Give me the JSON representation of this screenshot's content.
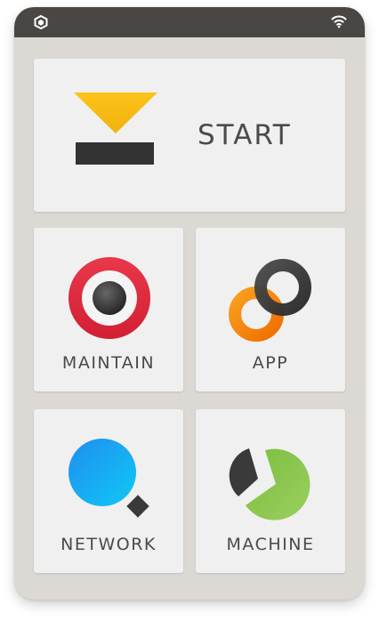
{
  "status_bar": {
    "logo_icon": "hexagon-logo-icon",
    "wifi_icon": "wifi-icon"
  },
  "tiles": {
    "start": {
      "label": "START",
      "icon": "start-funnel-icon"
    },
    "maintain": {
      "label": "MAINTAIN",
      "icon": "target-ring-icon"
    },
    "app": {
      "label": "APP",
      "icon": "linked-rings-icon"
    },
    "network": {
      "label": "NETWORK",
      "icon": "magnifier-icon"
    },
    "machine": {
      "label": "MACHINE",
      "icon": "pie-chart-icon"
    }
  },
  "colors": {
    "status_bar": "#4a4643",
    "device_bg": "#dcd8d3",
    "tile_bg": "#f0f0f0",
    "label_text": "#4a4a4a",
    "start_yellow": "#f5c018",
    "start_bar": "#333333",
    "maintain_red": "#e02d3e",
    "app_orange": "#f58a0a",
    "app_dark": "#3a3a3a",
    "network_blue": "#18a0f0",
    "machine_green": "#84c44c"
  }
}
